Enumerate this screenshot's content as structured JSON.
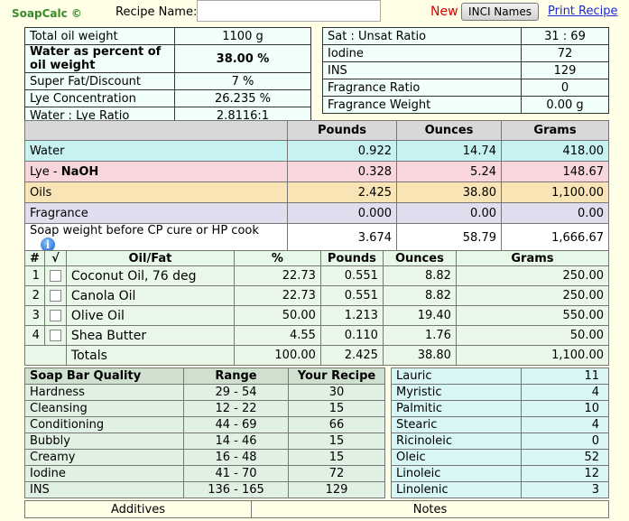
{
  "header": {
    "brand": "SoapCalc ©",
    "recipe_label": "Recipe Name:",
    "recipe_value": "",
    "new_label": "New",
    "inci_label": "INCI Names",
    "print_label": "Print Recipe"
  },
  "summary_left": [
    {
      "label": "Total oil weight",
      "value": "1100 g",
      "bold": false
    },
    {
      "label": "Water as percent of oil weight",
      "value": "38.00 %",
      "bold": true
    },
    {
      "label": "Super Fat/Discount",
      "value": "7 %",
      "bold": false
    },
    {
      "label": "Lye Concentration",
      "value": "26.235 %",
      "bold": false
    },
    {
      "label": "Water : Lye Ratio",
      "value": "2.8116:1",
      "bold": false
    }
  ],
  "summary_right": [
    {
      "label": "Sat : Unsat Ratio",
      "value": "31 : 69"
    },
    {
      "label": "Iodine",
      "value": "72"
    },
    {
      "label": "INS",
      "value": "129"
    },
    {
      "label": "Fragrance Ratio",
      "value": "0"
    },
    {
      "label": "Fragrance Weight",
      "value": "0.00 g"
    }
  ],
  "weights": {
    "headers": [
      "",
      "Pounds",
      "Ounces",
      "Grams"
    ],
    "rows": [
      {
        "label": "Water",
        "label_bold": "",
        "pounds": "0.922",
        "ounces": "14.74",
        "grams": "418.00"
      },
      {
        "label": "Lye - ",
        "label_bold": "NaOH",
        "pounds": "0.328",
        "ounces": "5.24",
        "grams": "148.67"
      },
      {
        "label": "Oils",
        "label_bold": "",
        "pounds": "2.425",
        "ounces": "38.80",
        "grams": "1,100.00"
      },
      {
        "label": "Fragrance",
        "label_bold": "",
        "pounds": "0.000",
        "ounces": "0.00",
        "grams": "0.00"
      },
      {
        "label": "Soap weight before CP cure or HP cook",
        "label_bold": "",
        "pounds": "3.674",
        "ounces": "58.79",
        "grams": "1,666.67"
      }
    ]
  },
  "oils": {
    "headers": [
      "#",
      "√",
      "Oil/Fat",
      "%",
      "Pounds",
      "Ounces",
      "Grams"
    ],
    "rows": [
      {
        "num": "1",
        "name": "Coconut Oil, 76 deg",
        "pct": "22.73",
        "pounds": "0.551",
        "ounces": "8.82",
        "grams": "250.00"
      },
      {
        "num": "2",
        "name": "Canola Oil",
        "pct": "22.73",
        "pounds": "0.551",
        "ounces": "8.82",
        "grams": "250.00"
      },
      {
        "num": "3",
        "name": "Olive Oil",
        "pct": "50.00",
        "pounds": "1.213",
        "ounces": "19.40",
        "grams": "550.00"
      },
      {
        "num": "4",
        "name": "Shea Butter",
        "pct": "4.55",
        "pounds": "0.110",
        "ounces": "1.76",
        "grams": "50.00"
      }
    ],
    "totals": {
      "label": "Totals",
      "pct": "100.00",
      "pounds": "2.425",
      "ounces": "38.80",
      "grams": "1,100.00"
    }
  },
  "quality": {
    "headers": [
      "Soap Bar Quality",
      "Range",
      "Your Recipe"
    ],
    "rows": [
      {
        "name": "Hardness",
        "range": "29 - 54",
        "value": "30"
      },
      {
        "name": "Cleansing",
        "range": "12 - 22",
        "value": "15"
      },
      {
        "name": "Conditioning",
        "range": "44 - 69",
        "value": "66"
      },
      {
        "name": "Bubbly",
        "range": "14 - 46",
        "value": "15"
      },
      {
        "name": "Creamy",
        "range": "16 - 48",
        "value": "15"
      },
      {
        "name": "Iodine",
        "range": "41 - 70",
        "value": "72"
      },
      {
        "name": "INS",
        "range": "136 - 165",
        "value": "129"
      }
    ]
  },
  "fatty_acids": [
    {
      "name": "Lauric",
      "value": "11"
    },
    {
      "name": "Myristic",
      "value": "4"
    },
    {
      "name": "Palmitic",
      "value": "10"
    },
    {
      "name": "Stearic",
      "value": "4"
    },
    {
      "name": "Ricinoleic",
      "value": "0"
    },
    {
      "name": "Oleic",
      "value": "52"
    },
    {
      "name": "Linoleic",
      "value": "12"
    },
    {
      "name": "Linolenic",
      "value": "3"
    }
  ],
  "bottom": {
    "additives": "Additives",
    "notes": "Notes"
  }
}
